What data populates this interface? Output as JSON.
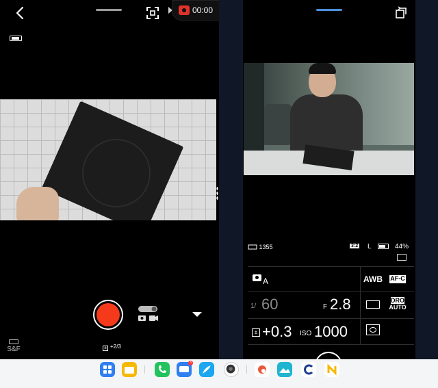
{
  "recording": {
    "time": "00:00"
  },
  "left_app": {
    "exposure_comp": "+2/3",
    "sf_label": "S&F"
  },
  "right_app": {
    "shots_remaining": "1355",
    "aspect_ratio": "3:2",
    "image_size": "L",
    "battery_percent": "44%",
    "shooting_mode_suffix": "A",
    "white_balance": "AWB",
    "focus_mode": "AF-C",
    "shutter_prefix": "1/",
    "shutter_value": "60",
    "aperture_prefix": "F",
    "aperture_value": "2.8",
    "dro_line1": "DRO",
    "dro_line2": "AUTO",
    "exposure_comp": "+0.3",
    "iso_label": "ISO",
    "iso_value": "1000"
  },
  "colors": {
    "shutter_red": "#f53a1c",
    "record_red": "#e0322c",
    "accent_blue": "#4a90d9",
    "panel_gap": "#101726",
    "dock_bg": "#f3f5f7"
  },
  "dock": {
    "icons": [
      "apps-grid-icon",
      "files-folder-icon",
      "phone-icon",
      "messages-icon",
      "notes-feather-icon",
      "camera-lens-icon",
      "paint-app-icon",
      "picture-editor-icon",
      "c-app-icon",
      "n-app-icon"
    ],
    "messages_badge": "3"
  }
}
